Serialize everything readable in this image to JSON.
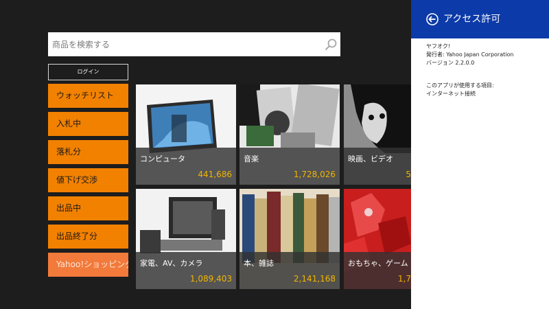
{
  "search": {
    "placeholder": "商品を検索する",
    "value": ""
  },
  "login": {
    "label": "ログイン"
  },
  "menu": {
    "items": [
      {
        "label": "ウォッチリスト"
      },
      {
        "label": "入札中"
      },
      {
        "label": "落札分"
      },
      {
        "label": "値下げ交渉"
      },
      {
        "label": "出品中"
      },
      {
        "label": "出品終了分"
      },
      {
        "label": "Yahoo!ショッピング"
      }
    ]
  },
  "tiles": [
    {
      "label": "コンピュータ",
      "count": "441,686"
    },
    {
      "label": "音楽",
      "count": "1,728,026"
    },
    {
      "label": "映画、ビデオ",
      "count": "5"
    },
    {
      "label": "家電、AV、カメラ",
      "count": "1,089,403"
    },
    {
      "label": "本、雑誌",
      "count": "2,141,168"
    },
    {
      "label": "おもちゃ、ゲーム",
      "count": "1,7"
    }
  ],
  "panel": {
    "title": "アクセス許可",
    "app_name": "ヤフオク!",
    "publisher": "発行者: Yahoo Japan Corporation",
    "version": "バージョン 2.2.0.0",
    "uses_heading": "このアプリが使用する項目:",
    "uses_item": "インターネット接続"
  },
  "colors": {
    "background": "#1d1d1d",
    "menu_orange": "#f28100",
    "menu_special": "#f27a3a",
    "panel_header": "#0c3aa8",
    "count_text": "#f2b500"
  },
  "icons": {
    "search": "magnifier-icon",
    "back": "circle-arrow-left-icon"
  }
}
